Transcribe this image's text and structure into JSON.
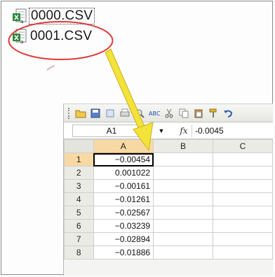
{
  "files": [
    {
      "name": "0000.CSV",
      "icon": "excel-csv-icon",
      "selected": true
    },
    {
      "name": "0001.CSV",
      "icon": "excel-csv-icon",
      "selected": false
    }
  ],
  "colors": {
    "highlight_oval": "#e03a3a",
    "arrow": "#f2e23a",
    "selected_header": "#f9d9a3",
    "excel_green": "#2f8a3c"
  },
  "spreadsheet": {
    "toolbar_icons": [
      "open-folder-icon",
      "save-icon",
      "permission-icon",
      "print-icon",
      "print-preview-icon",
      "spelling-icon",
      "cut-icon",
      "copy-icon",
      "paste-icon",
      "format-painter-icon",
      "undo-icon"
    ],
    "name_box": "A1",
    "formula_value": "-0.0045",
    "columns": [
      "A",
      "B",
      "C"
    ],
    "active_column": "A",
    "rows": [
      {
        "row": "1",
        "A": "−0.00454"
      },
      {
        "row": "2",
        "A": "0.001022"
      },
      {
        "row": "3",
        "A": "−0.00161"
      },
      {
        "row": "4",
        "A": "−0.01261"
      },
      {
        "row": "5",
        "A": "−0.02567"
      },
      {
        "row": "6",
        "A": "−0.03239"
      },
      {
        "row": "7",
        "A": "−0.02894"
      },
      {
        "row": "8",
        "A": "−0.01886"
      }
    ]
  }
}
